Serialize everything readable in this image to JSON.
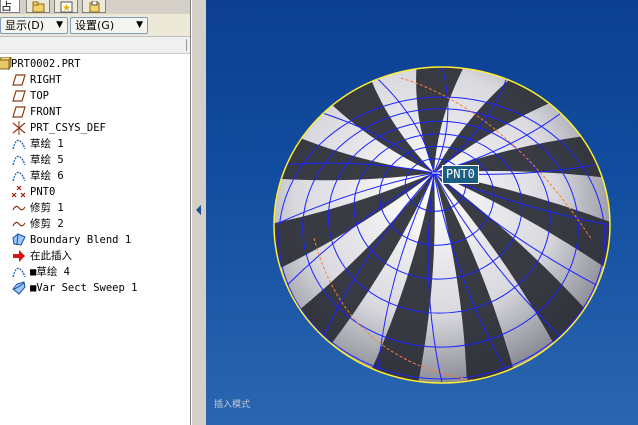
{
  "tabs": {
    "model_tree": "占"
  },
  "toolbar": {
    "show_label": "显示(D)",
    "settings_label": "设置(G)",
    "arrow": "▼"
  },
  "tree": {
    "items": [
      {
        "label": "PRT0002.PRT",
        "icon": "part-icon"
      },
      {
        "label": "RIGHT",
        "icon": "datum-plane-icon"
      },
      {
        "label": "TOP",
        "icon": "datum-plane-icon"
      },
      {
        "label": "FRONT",
        "icon": "datum-plane-icon"
      },
      {
        "label": "PRT_CSYS_DEF",
        "icon": "csys-icon"
      },
      {
        "label": "草绘 1",
        "icon": "sketch-icon"
      },
      {
        "label": "草绘 5",
        "icon": "sketch-icon"
      },
      {
        "label": "草绘 6",
        "icon": "sketch-icon"
      },
      {
        "label": "PNT0",
        "icon": "datum-point-icon"
      },
      {
        "label": "修剪 1",
        "icon": "trim-icon"
      },
      {
        "label": "修剪 2",
        "icon": "trim-icon"
      },
      {
        "label": "Boundary Blend 1",
        "icon": "boundary-blend-icon"
      },
      {
        "label": "在此插入",
        "icon": "insert-here-icon"
      },
      {
        "label": "■草绘 4",
        "icon": "sketch-icon"
      },
      {
        "label": "■Var Sect Sweep 1",
        "icon": "sweep-icon"
      }
    ]
  },
  "viewport": {
    "point_label": "PNT0",
    "status_text": "插入模式"
  },
  "colors": {
    "stripe_dark": "#2a2d35",
    "stripe_light": "#e8e8ec",
    "mesh": "#1a22ff",
    "edge": "#ffee33",
    "curve": "#ff7a3a"
  }
}
